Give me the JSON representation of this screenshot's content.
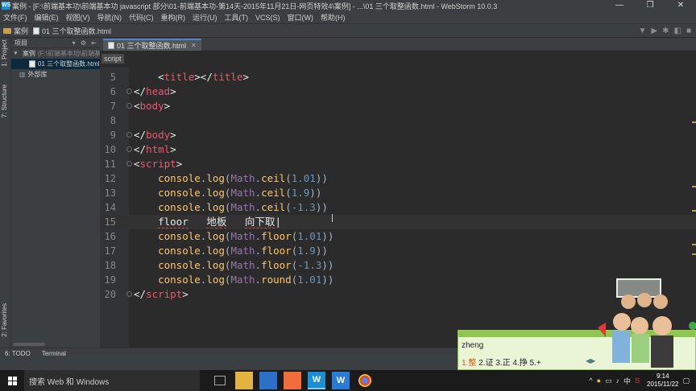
{
  "window": {
    "title": "案例 - [F:\\前端基本功\\前端基本功 javascript 部分\\01-前端基本功-第14天-2015年11月21日-网页特效4\\案例] - ...\\01 三个取整函数.html - WebStorm 10.0.3",
    "logo": "WS",
    "minimize": "—",
    "maximize": "❐",
    "close": "✕"
  },
  "menu": [
    "文件(F)",
    "编辑(E)",
    "视图(V)",
    "导航(N)",
    "代码(C)",
    "重构(R)",
    "运行(U)",
    "工具(T)",
    "VCS(S)",
    "窗口(W)",
    "帮助(H)"
  ],
  "navbar": {
    "crumb_folder": "案例",
    "crumb_file": "01 三个取整函数.html"
  },
  "left_strip": {
    "project": "1: Project",
    "structure": "7: Structure",
    "favorites": "2: Favorites"
  },
  "project_panel": {
    "header": "项目",
    "tree": [
      {
        "label": "案例",
        "dim": "(F:\\前端基本功\\前端基"
      },
      {
        "label": "01 三个取整函数.html"
      },
      {
        "label": "外部库"
      }
    ]
  },
  "editor_tab": {
    "label": "01 三个取整函数.html"
  },
  "context_tag": "script",
  "code_lines": [
    {
      "n": "5"
    },
    {
      "n": "6"
    },
    {
      "n": "7"
    },
    {
      "n": "8"
    },
    {
      "n": "9"
    },
    {
      "n": "10"
    },
    {
      "n": "11"
    },
    {
      "n": "12",
      "fn": "ceil",
      "arg": "1.01"
    },
    {
      "n": "13",
      "fn": "ceil",
      "arg": "1.9"
    },
    {
      "n": "14",
      "fn": "ceil",
      "arg": "-1.3"
    },
    {
      "n": "15",
      "ime": [
        "floor",
        "地板",
        "向下取"
      ]
    },
    {
      "n": "16",
      "fn": "floor",
      "arg": "1.01"
    },
    {
      "n": "17",
      "fn": "floor",
      "arg": "1.9"
    },
    {
      "n": "18",
      "fn": "floor",
      "arg": "-1.3"
    },
    {
      "n": "19",
      "fn": "round",
      "arg": "1.01"
    },
    {
      "n": "20"
    }
  ],
  "code_tokens": {
    "console": "console",
    "log": "log",
    "math": "Math",
    "title": "title",
    "head": "head",
    "body": "body",
    "html": "html",
    "script": "script"
  },
  "bottom_tools": {
    "todo": "6: TODO",
    "terminal": "Terminal"
  },
  "ime": {
    "composition": "zheng",
    "candidates": [
      "1.整",
      "2.证",
      "3.正",
      "4.挣",
      "5.+"
    ]
  },
  "taskbar": {
    "search_placeholder": "搜索 Web 和 Windows",
    "tray_lang": "中",
    "time": "9:14",
    "date": "2015/11/22"
  },
  "colors": {
    "editor_bg": "#2b2b2b",
    "tag": "#e8bf6a",
    "tag_name": "#e85a6d",
    "function": "#ffc66d",
    "number": "#6897bb",
    "object": "#9876aa"
  }
}
